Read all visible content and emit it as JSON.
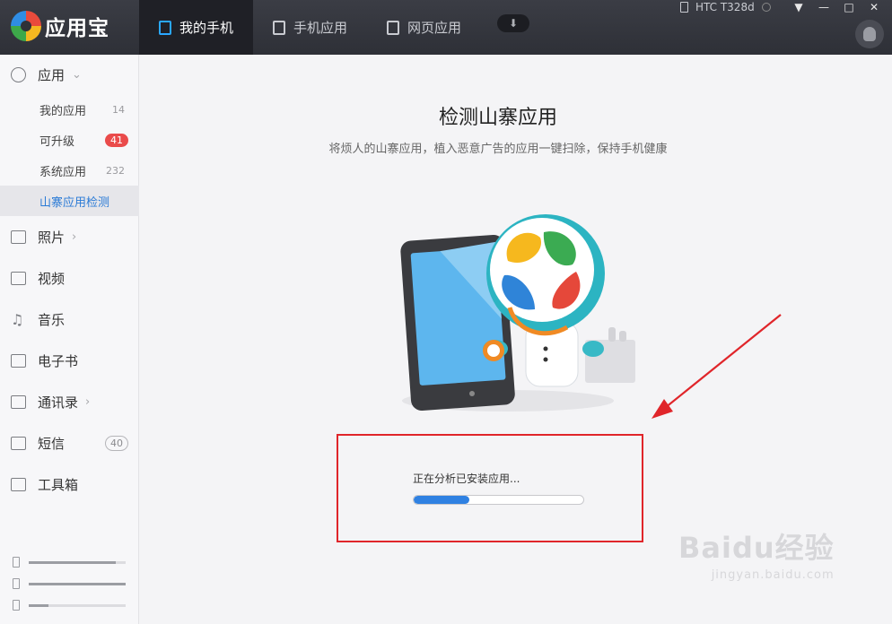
{
  "app": {
    "name": "应用宝"
  },
  "nav": {
    "tabs": [
      {
        "label": "我的手机"
      },
      {
        "label": "手机应用"
      },
      {
        "label": "网页应用"
      }
    ]
  },
  "device": {
    "name": "HTC T328d"
  },
  "window_controls": {
    "menu": "▼",
    "minimize": "—",
    "maximize": "□",
    "close": "✕"
  },
  "sidebar": {
    "apps": {
      "label": "应用"
    },
    "sub_items": [
      {
        "label": "我的应用",
        "count": "14"
      },
      {
        "label": "可升级",
        "count": "41"
      },
      {
        "label": "系统应用",
        "count": "232"
      },
      {
        "label": "山寨应用检测"
      }
    ],
    "items": [
      {
        "label": "照片"
      },
      {
        "label": "视频"
      },
      {
        "label": "音乐"
      },
      {
        "label": "电子书"
      },
      {
        "label": "通讯录"
      },
      {
        "label": "短信",
        "count": "40"
      },
      {
        "label": "工具箱"
      }
    ],
    "storage_fill": [
      0.9,
      1.0,
      0.2
    ]
  },
  "main": {
    "title": "检测山寨应用",
    "subtitle": "将烦人的山寨应用，植入恶意广告的应用一键扫除，保持手机健康",
    "status_text": "正在分析已安装应用...",
    "progress": 0.33
  },
  "watermark": {
    "main": "Baidu经验",
    "sub": "jingyan.baidu.com"
  },
  "colors": {
    "accent": "#2f81e2",
    "highlight_box": "#e0252a",
    "badge": "#ea4b4b"
  }
}
